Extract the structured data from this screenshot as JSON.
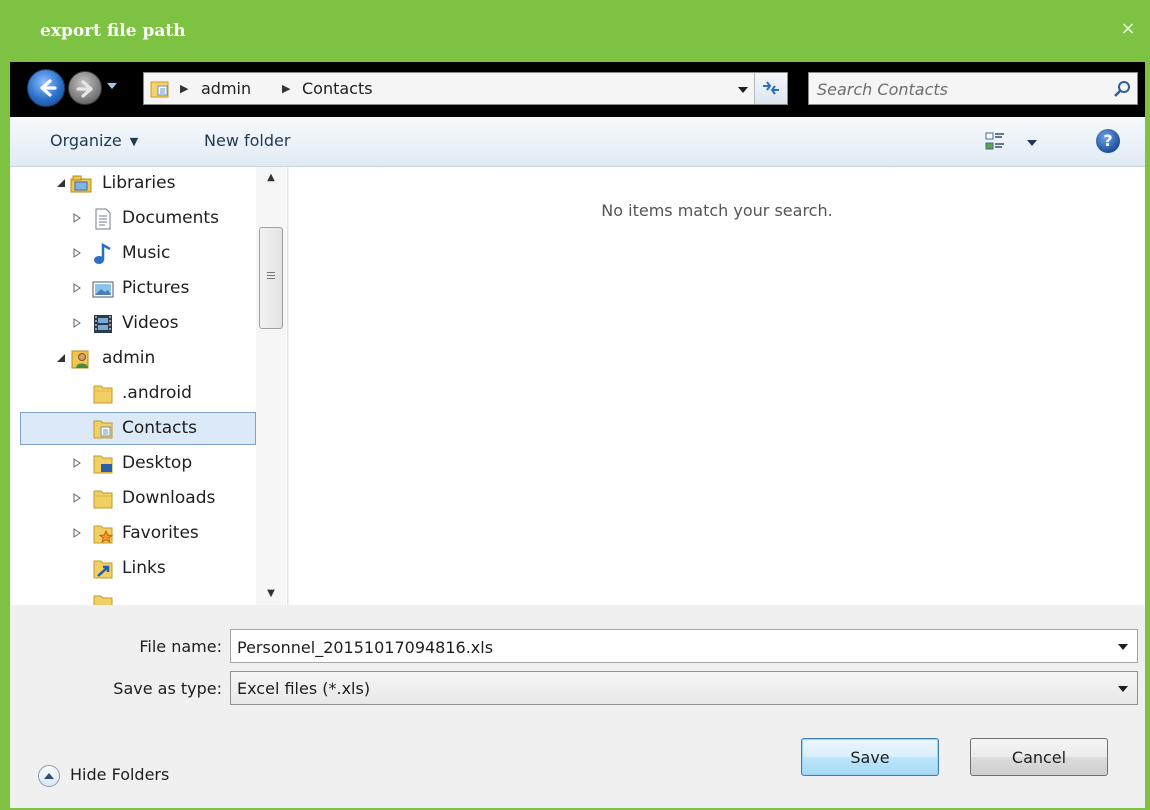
{
  "window": {
    "title": "export file path",
    "close_glyph": "×",
    "accent_color": "#7dc243"
  },
  "address_bar": {
    "breadcrumbs": [
      "admin",
      "Contacts"
    ],
    "search_placeholder": "Search Contacts"
  },
  "toolbar": {
    "organize_label": "Organize",
    "new_folder_label": "New folder",
    "help_glyph": "?"
  },
  "tree": {
    "items": [
      {
        "label": "Libraries",
        "icon": "libraries-icon",
        "expander": "expanded"
      },
      {
        "label": "Documents",
        "icon": "documents-icon",
        "expander": "collapsed"
      },
      {
        "label": "Music",
        "icon": "music-icon",
        "expander": "collapsed"
      },
      {
        "label": "Pictures",
        "icon": "pictures-icon",
        "expander": "collapsed"
      },
      {
        "label": "Videos",
        "icon": "videos-icon",
        "expander": "collapsed"
      },
      {
        "label": "admin",
        "icon": "user-folder-icon",
        "expander": "expanded"
      },
      {
        "label": ".android",
        "icon": "folder-icon",
        "expander": "none"
      },
      {
        "label": "Contacts",
        "icon": "contacts-folder-icon",
        "expander": "none",
        "selected": true
      },
      {
        "label": "Desktop",
        "icon": "desktop-folder-icon",
        "expander": "collapsed"
      },
      {
        "label": "Downloads",
        "icon": "downloads-folder-icon",
        "expander": "collapsed"
      },
      {
        "label": "Favorites",
        "icon": "favorites-folder-icon",
        "expander": "collapsed"
      },
      {
        "label": "Links",
        "icon": "links-folder-icon",
        "expander": "none"
      }
    ]
  },
  "content": {
    "empty_message": "No items match your search."
  },
  "form": {
    "file_name_label": "File name:",
    "file_name_value": "Personnel_20151017094816.xls",
    "save_type_label": "Save as type:",
    "save_type_value": "Excel files (*.xls)"
  },
  "footer": {
    "hide_folders_label": "Hide Folders",
    "save_label": "Save",
    "cancel_label": "Cancel"
  }
}
